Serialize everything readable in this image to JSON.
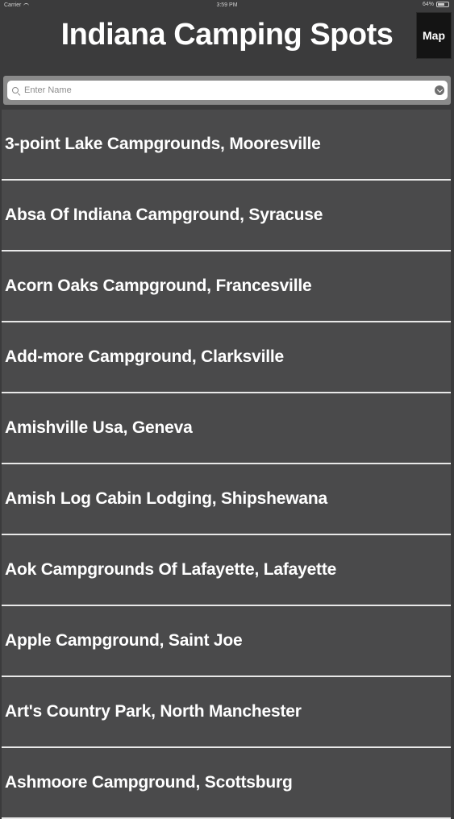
{
  "status_bar": {
    "carrier": "Carrier",
    "time": "3:59 PM",
    "battery": "64%"
  },
  "header": {
    "title": "Indiana Camping Spots",
    "map_button": "Map"
  },
  "search": {
    "placeholder": "Enter Name"
  },
  "list": {
    "items": [
      "3-point Lake Campgrounds, Mooresville",
      "Absa Of Indiana Campground, Syracuse",
      "Acorn Oaks Campground, Francesville",
      "Add-more Campground, Clarksville",
      "Amishville Usa, Geneva",
      "Amish Log Cabin Lodging, Shipshewana",
      "Aok Campgrounds Of Lafayette, Lafayette",
      "Apple Campground, Saint Joe",
      "Art's Country Park, North Manchester",
      "Ashmoore Campground, Scottsburg"
    ]
  },
  "colors": {
    "background": "#3b3b3c",
    "row": "#4a4a4b",
    "separator": "#e9e9e9",
    "map_button": "#141414",
    "text": "#ffffff"
  }
}
